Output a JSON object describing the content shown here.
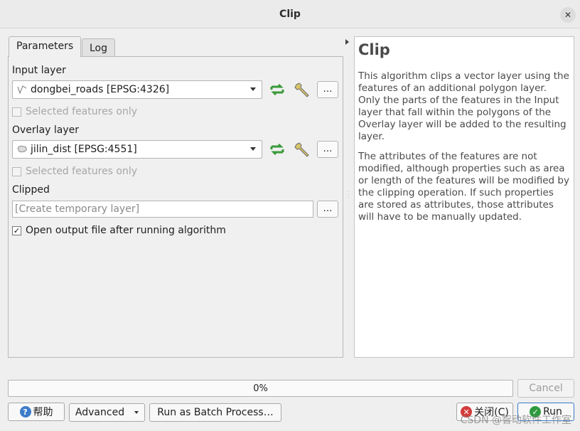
{
  "window": {
    "title": "Clip",
    "close_glyph": "✕"
  },
  "tabs": [
    {
      "label": "Parameters",
      "active": true
    },
    {
      "label": "Log",
      "active": false
    }
  ],
  "input_layer": {
    "label": "Input layer",
    "value": "dongbei_roads [EPSG:4326]",
    "selected_only": "Selected features only",
    "dots": "…"
  },
  "overlay_layer": {
    "label": "Overlay layer",
    "value": "jilin_dist [EPSG:4551]",
    "selected_only": "Selected features only",
    "dots": "…"
  },
  "clipped": {
    "label": "Clipped",
    "value": "[Create temporary layer]",
    "dots": "…"
  },
  "open_output": {
    "label": "Open output file after running algorithm",
    "checked": true,
    "check_glyph": "✓"
  },
  "help": {
    "title": "Clip",
    "para1": "This algorithm clips a vector layer using the features of an additional polygon layer. Only the parts of the features in the Input layer that fall within the polygons of the Overlay layer will be added to the resulting layer.",
    "para2": "The attributes of the features are not modified, although properties such as area or length of the features will be modified by the clipping operation. If such properties are stored as attributes, those attributes will have to be manually updated."
  },
  "progress": {
    "text": "0%",
    "value": 0
  },
  "buttons": {
    "cancel": "Cancel",
    "help": "帮助",
    "advanced": "Advanced",
    "batch": "Run as Batch Process…",
    "close": "关闭(C)",
    "run": "Run"
  },
  "watermark": "CSDN @智动软件工作室",
  "colors": {
    "refresh_green": "#3a9a3a",
    "help_blue": "#3d7cc9",
    "close_red": "#d23b3b",
    "run_green": "#2e9a3e"
  }
}
